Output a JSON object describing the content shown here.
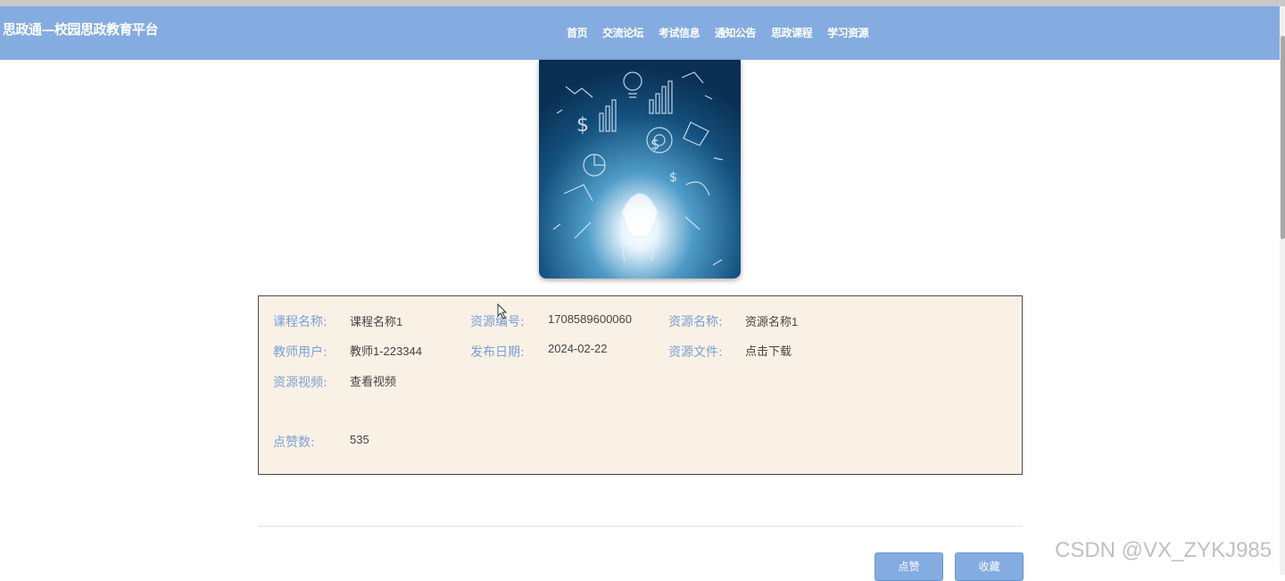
{
  "header": {
    "brand": "思政通—校园思政教育平台",
    "nav": [
      "首页",
      "交流论坛",
      "考试信息",
      "通知公告",
      "思政课程",
      "学习资源"
    ]
  },
  "cover": {
    "icon": "lightbulb-business-sketch-image"
  },
  "details": {
    "course_name_label": "课程名称:",
    "course_name": "课程名称1",
    "resource_no_label": "资源编号:",
    "resource_no": "1708589600060",
    "resource_name_label": "资源名称:",
    "resource_name": "资源名称1",
    "teacher_label": "教师用户:",
    "teacher": "教师1-223344",
    "publish_date_label": "发布日期:",
    "publish_date": "2024-02-22",
    "resource_file_label": "资源文件:",
    "resource_file": "点击下载",
    "resource_video_label": "资源视频:",
    "resource_video": "查看视频",
    "likes_label": "点赞数:",
    "likes": "535"
  },
  "actions": {
    "like": "点赞",
    "favorite": "收藏"
  },
  "watermark": "CSDN @VX_ZYKJ985",
  "colors": {
    "navbar": "#84ace0",
    "panel": "#faf1e6",
    "label": "#7aa0d6"
  }
}
